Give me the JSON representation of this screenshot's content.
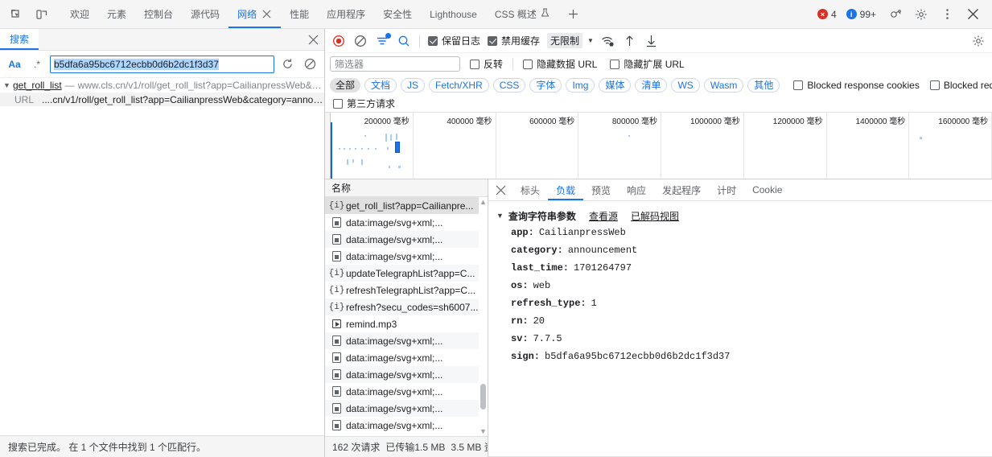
{
  "tabstrip": {
    "icons": [
      {
        "name": "inspect-element-icon"
      },
      {
        "name": "device-toolbar-icon"
      }
    ],
    "tabs": [
      {
        "label": "欢迎",
        "active": false,
        "closable": false
      },
      {
        "label": "元素",
        "active": false,
        "closable": false
      },
      {
        "label": "控制台",
        "active": false,
        "closable": false
      },
      {
        "label": "源代码",
        "active": false,
        "closable": false
      },
      {
        "label": "网络",
        "active": true,
        "closable": true
      },
      {
        "label": "性能",
        "active": false,
        "closable": false
      },
      {
        "label": "应用程序",
        "active": false,
        "closable": false
      },
      {
        "label": "安全性",
        "active": false,
        "closable": false
      },
      {
        "label": "Lighthouse",
        "active": false,
        "closable": false
      },
      {
        "label": "CSS 概述",
        "active": false,
        "closable": false
      }
    ],
    "more_tabs_label": "+",
    "errors_count": "4",
    "info_count": "99+",
    "accent_blue": "#1a73e8",
    "error_red": "#d93025"
  },
  "search_panel": {
    "tab_label": "搜索",
    "close_label": "✕",
    "match_case_label": "Aa",
    "regex_label": ".*",
    "query_value": "b5dfa6a95bc6712ecbb0d6b2dc1f3d37",
    "query_placeholder": "搜索",
    "refresh_icon": "refresh-icon",
    "clear_icon": "clear-icon",
    "result": {
      "triangle": "▼",
      "file": "get_roll_list",
      "dash": "—",
      "url": "www.cls.cn/v1/roll/get_roll_list?app=CailianpressWeb&c...",
      "row_label": "URL",
      "row_text": "....cn/v1/roll/get_roll_list?app=CailianpressWeb&category=announ..."
    },
    "status": "搜索已完成。  在 1 个文件中找到 1 个匹配行。"
  },
  "network": {
    "toolbar": {
      "record_icon": "record-button",
      "clear_icon": "clear-icon",
      "filter_icon": "filter-icon",
      "search_icon": "search-icon",
      "preserve_log": {
        "label": "保留日志",
        "checked": true
      },
      "disable_cache": {
        "label": "禁用缓存",
        "checked": true
      },
      "throttle_value": "无限制",
      "throttle_caret": "▼",
      "wifi_icon": "network-conditions-icon",
      "import_icon": "import-har-icon",
      "export_icon": "export-har-icon",
      "settings_icon": "gear-icon"
    },
    "filterbar": {
      "filter_placeholder": "筛选器",
      "filter_value": "",
      "invert": {
        "label": "反转",
        "checked": false
      },
      "hide_data_urls": {
        "label": "隐藏数据 URL",
        "checked": false
      },
      "hide_ext_urls": {
        "label": "隐藏扩展 URL",
        "checked": false
      }
    },
    "types": [
      {
        "label": "全部",
        "active": true
      },
      {
        "label": "文档",
        "active": false
      },
      {
        "label": "JS",
        "active": false
      },
      {
        "label": "Fetch/XHR",
        "active": false
      },
      {
        "label": "CSS",
        "active": false
      },
      {
        "label": "字体",
        "active": false
      },
      {
        "label": "Img",
        "active": false
      },
      {
        "label": "媒体",
        "active": false
      },
      {
        "label": "清单",
        "active": false
      },
      {
        "label": "WS",
        "active": false
      },
      {
        "label": "Wasm",
        "active": false
      },
      {
        "label": "其他",
        "active": false
      }
    ],
    "extra_checks": [
      {
        "label": "Blocked response cookies",
        "checked": false
      },
      {
        "label": "Blocked requests",
        "checked": false
      }
    ],
    "third_party": {
      "label": "第三方请求",
      "checked": false
    },
    "overview_ticks": [
      "200000 毫秒",
      "400000 毫秒",
      "600000 毫秒",
      "800000 毫秒",
      "1000000 毫秒",
      "1200000 毫秒",
      "1400000 毫秒",
      "1600000 毫秒"
    ],
    "list": {
      "column_name": "名称",
      "rows": [
        {
          "name": "get_roll_list?app=Cailianpre...",
          "icon": "xhr-icon",
          "selected": true
        },
        {
          "name": "data:image/svg+xml;...",
          "icon": "image-icon",
          "selected": false
        },
        {
          "name": "data:image/svg+xml;...",
          "icon": "image-icon",
          "selected": false
        },
        {
          "name": "data:image/svg+xml;...",
          "icon": "image-icon",
          "selected": false
        },
        {
          "name": "updateTelegraphList?app=C...",
          "icon": "xhr-icon",
          "selected": false
        },
        {
          "name": "refreshTelegraphList?app=C...",
          "icon": "xhr-icon",
          "selected": false
        },
        {
          "name": "refresh?secu_codes=sh6007...",
          "icon": "xhr-icon",
          "selected": false
        },
        {
          "name": "remind.mp3",
          "icon": "media-icon",
          "selected": false
        },
        {
          "name": "data:image/svg+xml;...",
          "icon": "image-icon",
          "selected": false
        },
        {
          "name": "data:image/svg+xml;...",
          "icon": "image-icon",
          "selected": false
        },
        {
          "name": "data:image/svg+xml;...",
          "icon": "image-icon",
          "selected": false
        },
        {
          "name": "data:image/svg+xml;...",
          "icon": "image-icon",
          "selected": false
        },
        {
          "name": "data:image/svg+xml;...",
          "icon": "image-icon",
          "selected": false
        },
        {
          "name": "data:image/svg+xml;...",
          "icon": "image-icon",
          "selected": false
        }
      ],
      "scroll_up": "▲",
      "scroll_down": "▼"
    },
    "status": {
      "requests": "162 次请求",
      "transferred": "已传输1.5 MB",
      "resources": "3.5 MB 资"
    },
    "details": {
      "close_label": "✕",
      "tabs": [
        {
          "label": "标头",
          "active": false
        },
        {
          "label": "负载",
          "active": true
        },
        {
          "label": "预览",
          "active": false
        },
        {
          "label": "响应",
          "active": false
        },
        {
          "label": "发起程序",
          "active": false
        },
        {
          "label": "计时",
          "active": false
        },
        {
          "label": "Cookie",
          "active": false
        }
      ],
      "payload": {
        "triangle": "▼",
        "section_title": "查询字符串参数",
        "view_source_label": "查看源",
        "decoded_label": "已解码视图",
        "params": [
          {
            "key": "app:",
            "value": "CailianpressWeb"
          },
          {
            "key": "category:",
            "value": "announcement"
          },
          {
            "key": "last_time:",
            "value": "1701264797"
          },
          {
            "key": "os:",
            "value": "web"
          },
          {
            "key": "refresh_type:",
            "value": "1"
          },
          {
            "key": "rn:",
            "value": "20"
          },
          {
            "key": "sv:",
            "value": "7.7.5"
          },
          {
            "key": "sign:",
            "value": "b5dfa6a95bc6712ecbb0d6b2dc1f3d37"
          }
        ]
      }
    }
  }
}
